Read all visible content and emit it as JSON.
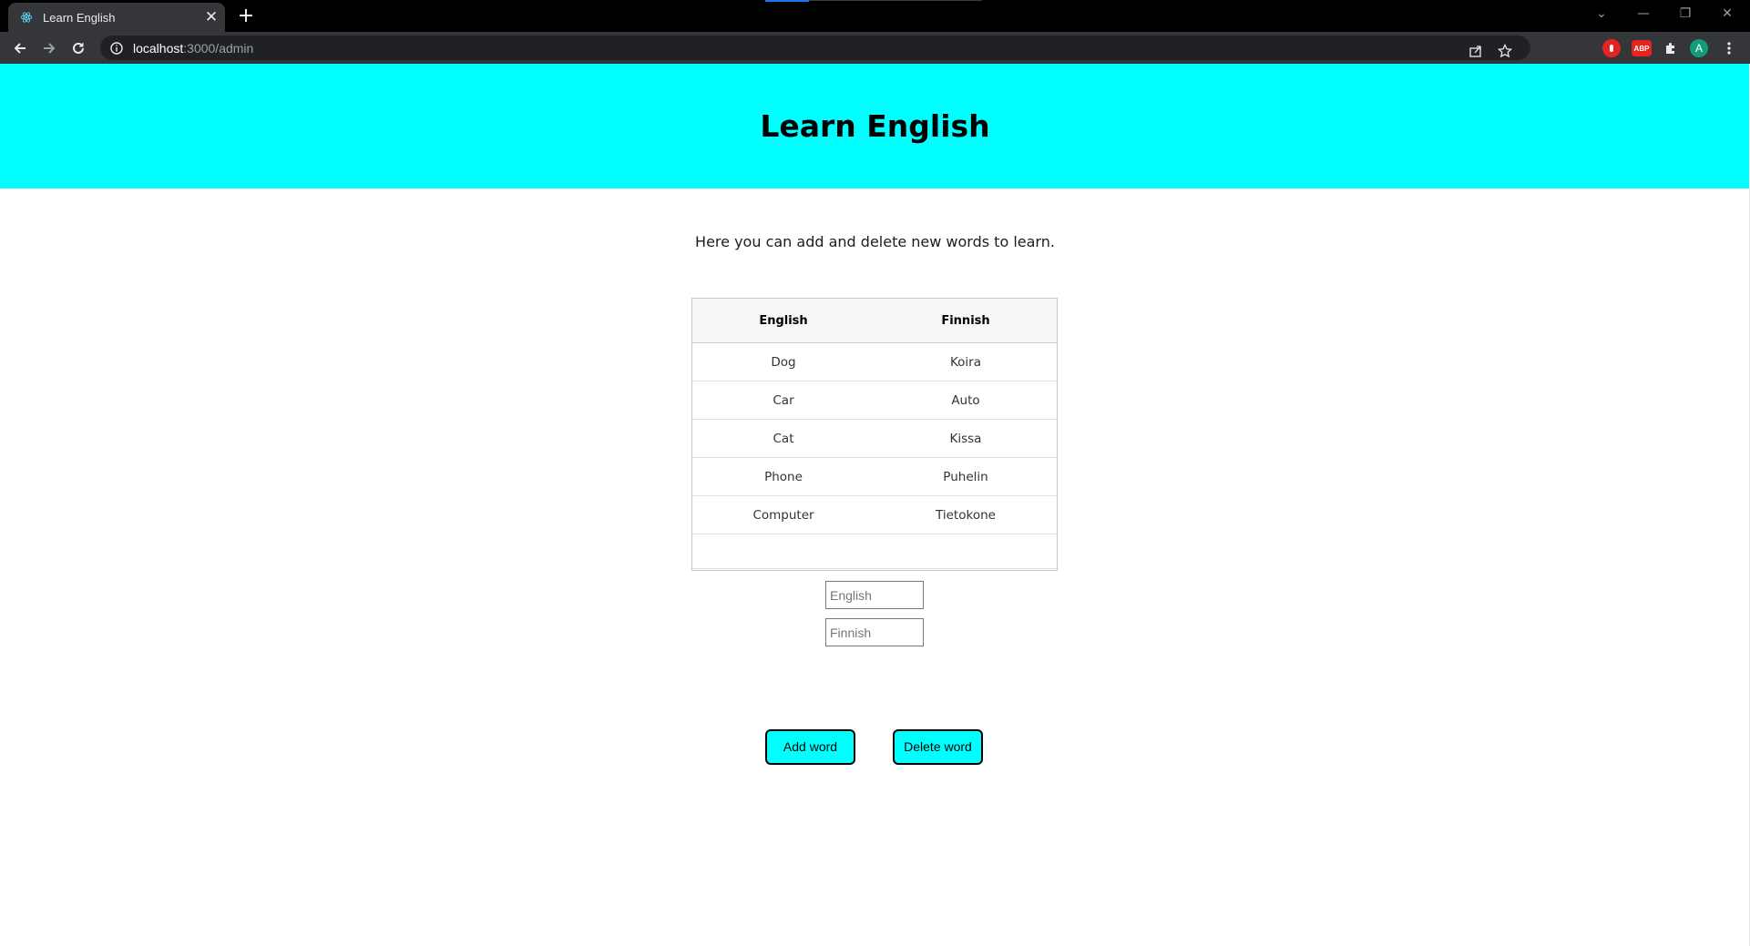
{
  "browser": {
    "tab_title": "Learn English",
    "tab_close": "✕",
    "new_tab": "+",
    "url_host": "localhost",
    "url_path": ":3000/admin",
    "profile_initial": "A",
    "controls": {
      "minimize": "—",
      "restore": "❐",
      "close": "✕",
      "menu": "⌄"
    }
  },
  "page": {
    "title": "Learn English",
    "intro": "Here you can add and delete new words to learn."
  },
  "table": {
    "headers": [
      "English",
      "Finnish"
    ],
    "rows": [
      [
        "Dog",
        "Koira"
      ],
      [
        "Car",
        "Auto"
      ],
      [
        "Cat",
        "Kissa"
      ],
      [
        "Phone",
        "Puhelin"
      ],
      [
        "Computer",
        "Tietokone"
      ]
    ]
  },
  "form": {
    "english_placeholder": "English",
    "finnish_placeholder": "Finnish",
    "english_value": "",
    "finnish_value": "",
    "add_label": "Add word",
    "delete_label": "Delete word"
  },
  "colors": {
    "accent": "#00ffff",
    "chrome_dark": "#35363a",
    "tab_bar": "#000000"
  },
  "icons": {
    "favicon": "react-icon",
    "back": "arrow-left-icon",
    "forward": "arrow-right-icon",
    "reload": "reload-icon",
    "info": "info-icon",
    "share": "share-icon",
    "bookmark": "star-icon",
    "extensions": "puzzle-icon"
  }
}
